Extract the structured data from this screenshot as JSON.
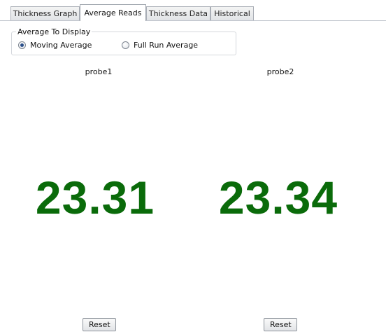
{
  "tabs": [
    {
      "label": "Thickness Graph",
      "active": false
    },
    {
      "label": "Average Reads",
      "active": true
    },
    {
      "label": "Thickness Data",
      "active": false
    },
    {
      "label": "Historical",
      "active": false
    }
  ],
  "average_group": {
    "title": "Average To Display",
    "options": [
      {
        "label": "Moving Average",
        "selected": true
      },
      {
        "label": "Full Run Average",
        "selected": false
      }
    ]
  },
  "probes": [
    {
      "name": "probe1",
      "value": "23.31",
      "reset_label": "Reset"
    },
    {
      "name": "probe2",
      "value": "23.34",
      "reset_label": "Reset"
    }
  ],
  "colors": {
    "value_text": "#0a6b0a"
  }
}
